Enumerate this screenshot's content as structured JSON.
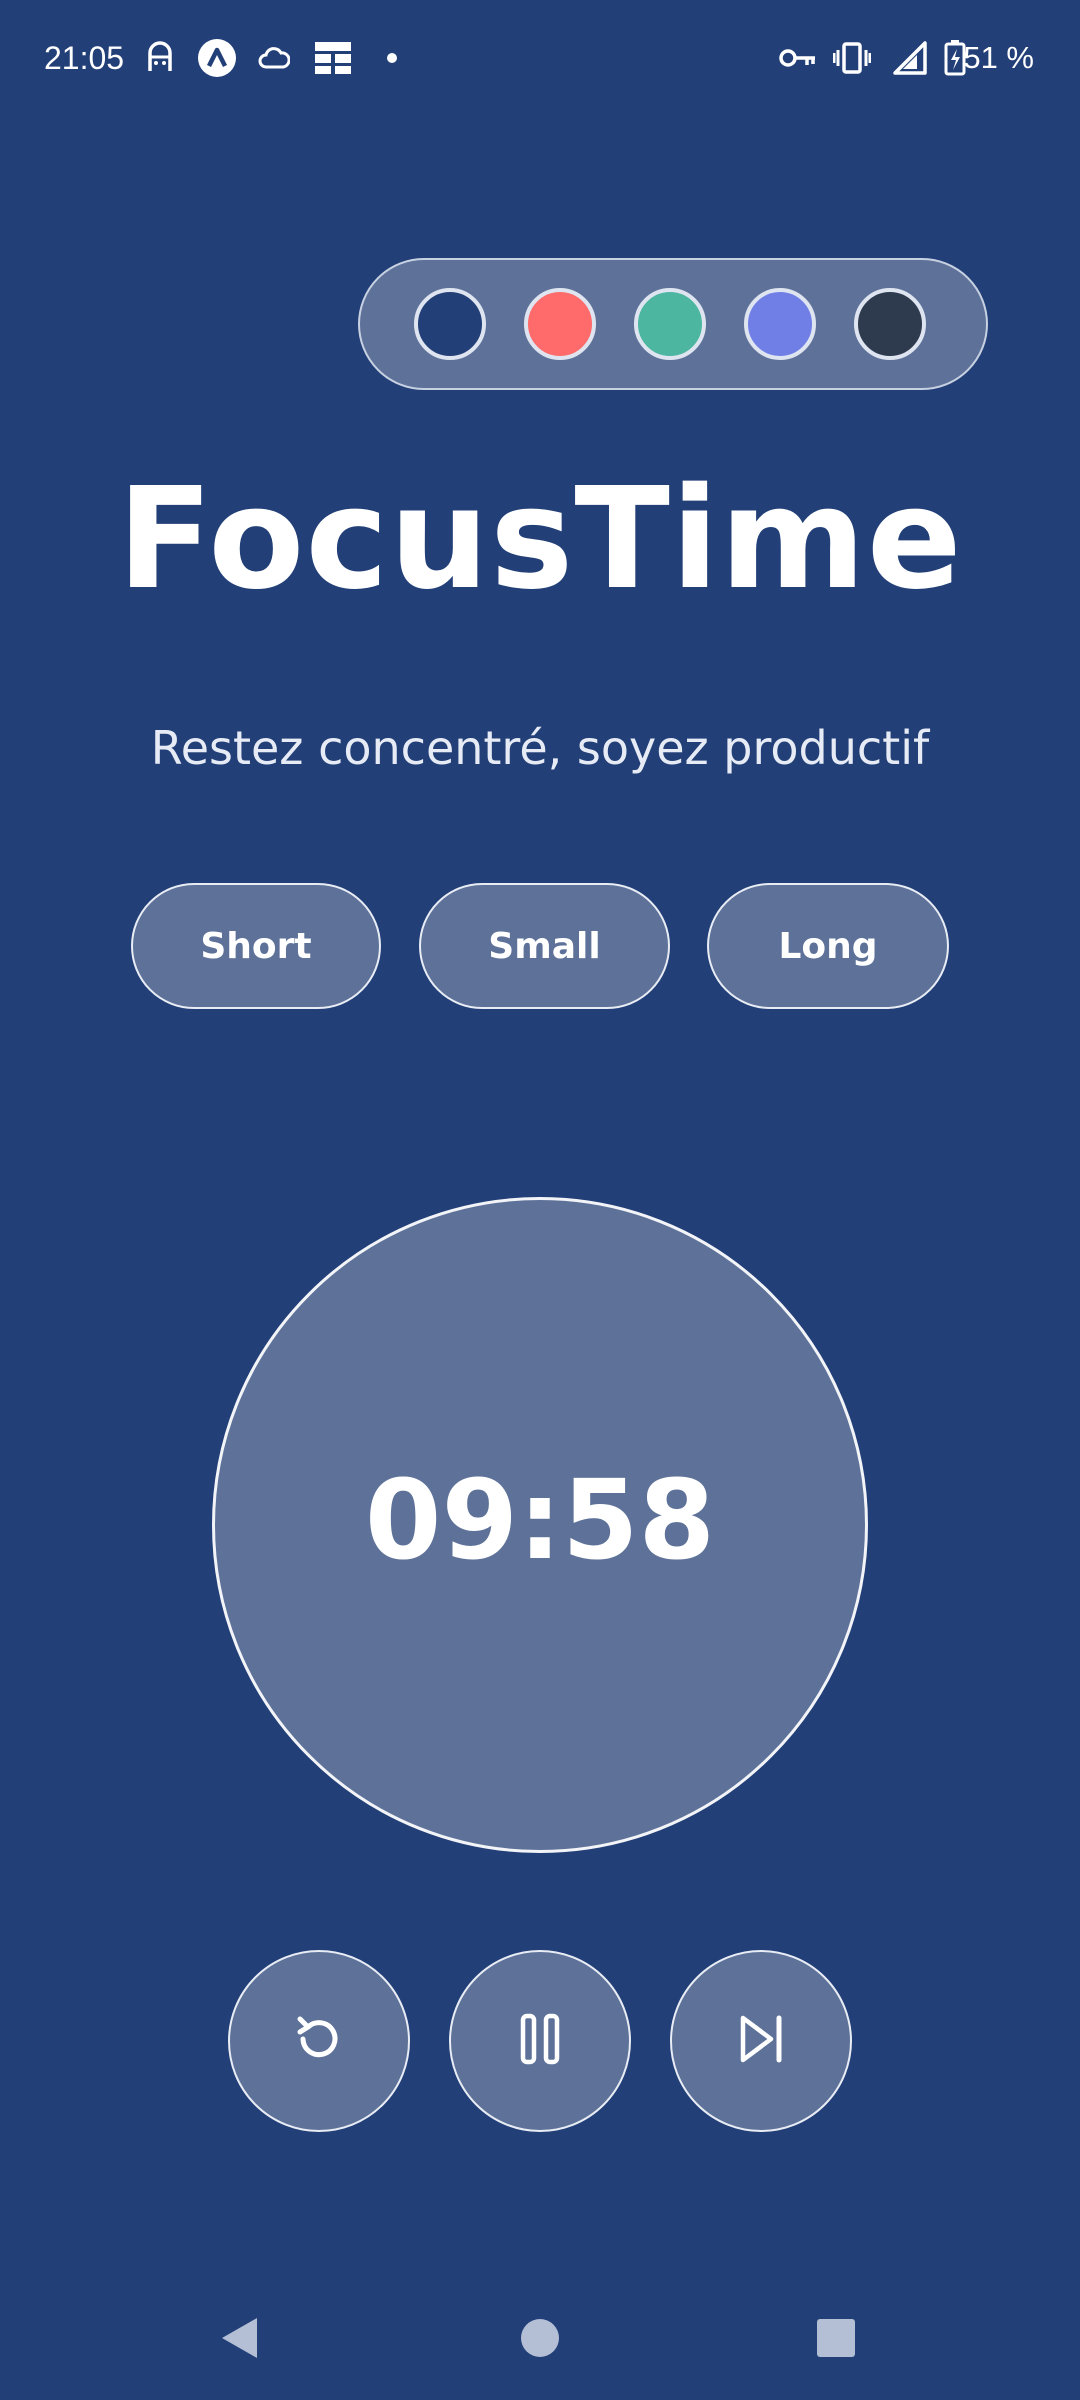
{
  "status_bar": {
    "time": "21:05",
    "battery_percent": "51 %",
    "left_icons": [
      "ghost-icon",
      "alert-a-icon",
      "cloud-icon",
      "grid-icon",
      "dot-icon"
    ],
    "right_icons": [
      "key-icon",
      "vibrate-icon",
      "signal-icon",
      "battery-charging-icon"
    ]
  },
  "theme": {
    "swatches": [
      {
        "name": "navy",
        "color": "#223f77"
      },
      {
        "name": "coral",
        "color": "#ff6b6b"
      },
      {
        "name": "teal",
        "color": "#4db6a0"
      },
      {
        "name": "periwinkle",
        "color": "#6f7fe6"
      },
      {
        "name": "charcoal",
        "color": "#2e3a4e"
      }
    ]
  },
  "app": {
    "title": "FocusTime",
    "subtitle": "Restez concentré, soyez productif"
  },
  "modes": [
    {
      "label": "Short"
    },
    {
      "label": "Small"
    },
    {
      "label": "Long"
    }
  ],
  "timer": {
    "display": "09:58"
  },
  "controls": {
    "reset": "reset-icon",
    "pause": "pause-icon",
    "skip": "skip-next-icon"
  },
  "colors": {
    "background": "#223f77",
    "surface": "#5e7299",
    "border": "#e8ecf4",
    "text": "#ffffff"
  },
  "nav": {
    "back": "back-triangle-icon",
    "home": "home-circle-icon",
    "recents": "recents-square-icon"
  }
}
